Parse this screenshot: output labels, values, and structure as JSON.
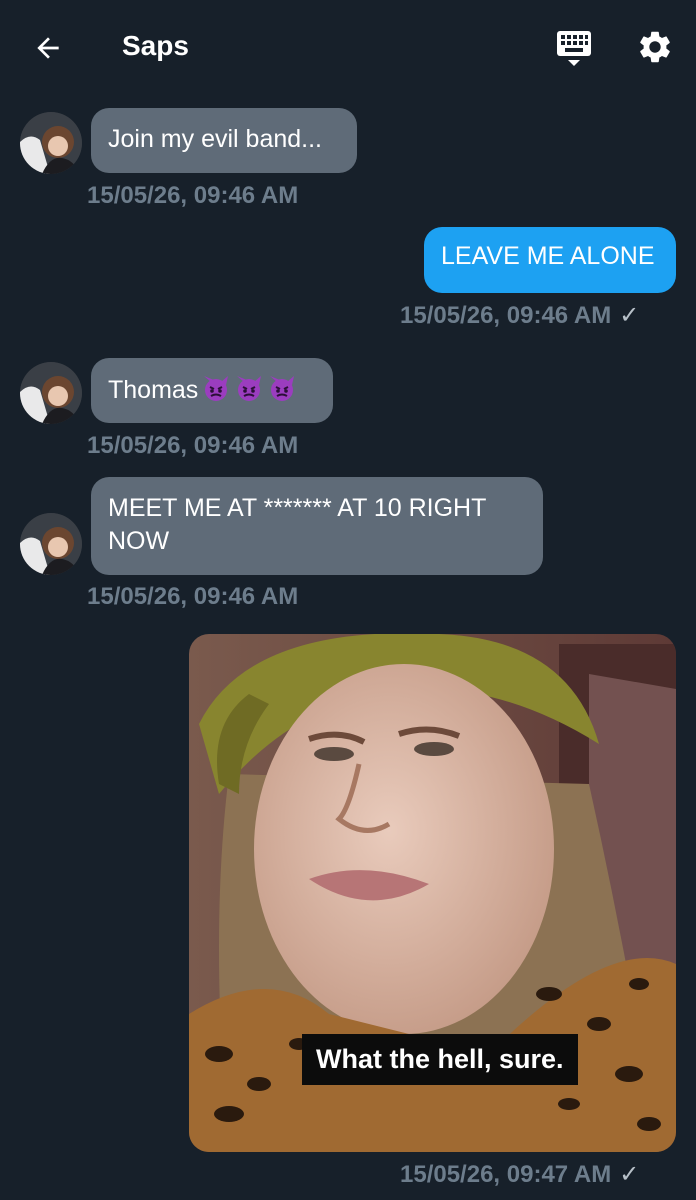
{
  "header": {
    "title": "Saps",
    "back_icon": "arrow-left-icon",
    "keyboard_icon": "keyboard-icon",
    "settings_icon": "gear-icon"
  },
  "messages": [
    {
      "direction": "incoming",
      "text": "Join my evil band...",
      "timestamp": "15/05/26, 09:46 AM"
    },
    {
      "direction": "outgoing",
      "text": "LEAVE ME ALONE",
      "timestamp": "15/05/26, 09:46 AM",
      "read_mark": "✓"
    },
    {
      "direction": "incoming",
      "text": "Thomas",
      "emoji": [
        "imp-emoji",
        "imp-emoji",
        "imp-emoji"
      ],
      "timestamp": "15/05/26, 09:46 AM"
    },
    {
      "direction": "incoming",
      "text_line1": "MEET ME AT ******* AT 10 RIGHT",
      "text_line2": "NOW",
      "timestamp": "15/05/26, 09:46 AM"
    },
    {
      "direction": "outgoing",
      "type": "image",
      "caption": "What the hell, sure.",
      "timestamp": "15/05/26, 09:47 AM",
      "read_mark": "✓"
    }
  ],
  "colors": {
    "background": "#17202a",
    "incoming_bubble": "#5f6b78",
    "outgoing_bubble": "#1da1f2",
    "timestamp": "#6d7d8c"
  }
}
